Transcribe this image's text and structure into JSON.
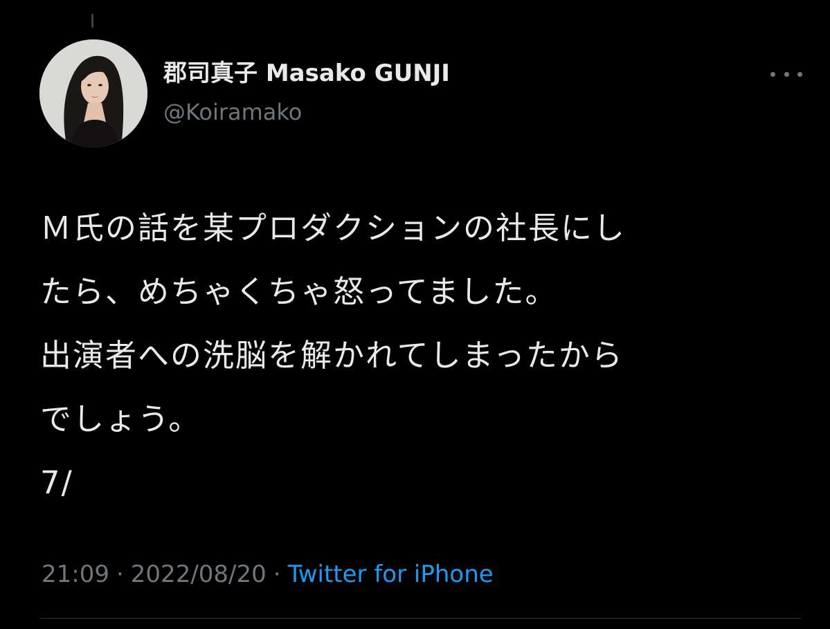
{
  "author": {
    "display_name": "郡司真子 Masako GUNJI",
    "handle": "@Koiramako"
  },
  "tweet": {
    "lines": [
      "Ｍ氏の話を某プロダクションの社長にし",
      "たら、めちゃくちゃ怒ってました。",
      "出演者への洗脳を解かれてしまったから",
      "でしょう。",
      "7/"
    ]
  },
  "meta": {
    "time": "21:09",
    "separator": "·",
    "date": "2022/08/20",
    "source": "Twitter for iPhone"
  },
  "icons": {
    "more": "more-horizontal-icon"
  },
  "colors": {
    "background": "#000000",
    "text": "#e7e9ea",
    "secondary_text": "#71767b",
    "link": "#1d9bf0",
    "divider": "#2f3336"
  }
}
